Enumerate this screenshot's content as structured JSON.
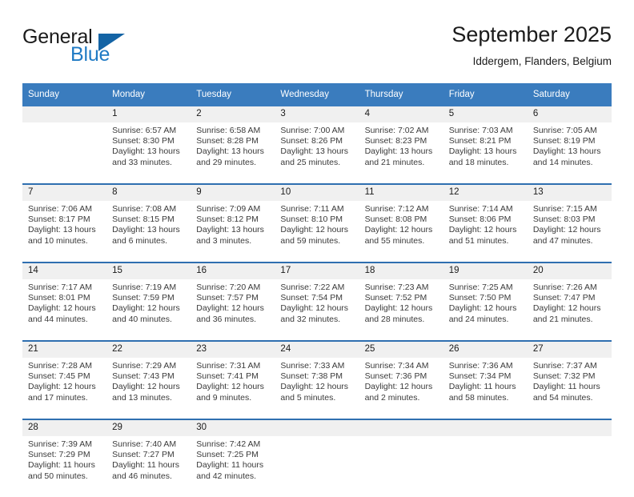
{
  "logo": {
    "word1": "General",
    "word2": "Blue",
    "triangle_color": "#1464a5",
    "blue_color": "#1f7ac4"
  },
  "header": {
    "title": "September 2025",
    "subtitle": "Iddergem, Flanders, Belgium"
  },
  "colors": {
    "header_blue": "#3a7cbe",
    "row_divider_blue": "#2f6fb0",
    "day_number_band": "#f0f0f0"
  },
  "calendar": {
    "weekdays": [
      "Sunday",
      "Monday",
      "Tuesday",
      "Wednesday",
      "Thursday",
      "Friday",
      "Saturday"
    ],
    "weeks": [
      {
        "days": [
          {
            "num": "",
            "sunrise": "",
            "sunset": "",
            "daylight1": "",
            "daylight2": ""
          },
          {
            "num": "1",
            "sunrise": "Sunrise: 6:57 AM",
            "sunset": "Sunset: 8:30 PM",
            "daylight1": "Daylight: 13 hours",
            "daylight2": "and 33 minutes."
          },
          {
            "num": "2",
            "sunrise": "Sunrise: 6:58 AM",
            "sunset": "Sunset: 8:28 PM",
            "daylight1": "Daylight: 13 hours",
            "daylight2": "and 29 minutes."
          },
          {
            "num": "3",
            "sunrise": "Sunrise: 7:00 AM",
            "sunset": "Sunset: 8:26 PM",
            "daylight1": "Daylight: 13 hours",
            "daylight2": "and 25 minutes."
          },
          {
            "num": "4",
            "sunrise": "Sunrise: 7:02 AM",
            "sunset": "Sunset: 8:23 PM",
            "daylight1": "Daylight: 13 hours",
            "daylight2": "and 21 minutes."
          },
          {
            "num": "5",
            "sunrise": "Sunrise: 7:03 AM",
            "sunset": "Sunset: 8:21 PM",
            "daylight1": "Daylight: 13 hours",
            "daylight2": "and 18 minutes."
          },
          {
            "num": "6",
            "sunrise": "Sunrise: 7:05 AM",
            "sunset": "Sunset: 8:19 PM",
            "daylight1": "Daylight: 13 hours",
            "daylight2": "and 14 minutes."
          }
        ]
      },
      {
        "days": [
          {
            "num": "7",
            "sunrise": "Sunrise: 7:06 AM",
            "sunset": "Sunset: 8:17 PM",
            "daylight1": "Daylight: 13 hours",
            "daylight2": "and 10 minutes."
          },
          {
            "num": "8",
            "sunrise": "Sunrise: 7:08 AM",
            "sunset": "Sunset: 8:15 PM",
            "daylight1": "Daylight: 13 hours",
            "daylight2": "and 6 minutes."
          },
          {
            "num": "9",
            "sunrise": "Sunrise: 7:09 AM",
            "sunset": "Sunset: 8:12 PM",
            "daylight1": "Daylight: 13 hours",
            "daylight2": "and 3 minutes."
          },
          {
            "num": "10",
            "sunrise": "Sunrise: 7:11 AM",
            "sunset": "Sunset: 8:10 PM",
            "daylight1": "Daylight: 12 hours",
            "daylight2": "and 59 minutes."
          },
          {
            "num": "11",
            "sunrise": "Sunrise: 7:12 AM",
            "sunset": "Sunset: 8:08 PM",
            "daylight1": "Daylight: 12 hours",
            "daylight2": "and 55 minutes."
          },
          {
            "num": "12",
            "sunrise": "Sunrise: 7:14 AM",
            "sunset": "Sunset: 8:06 PM",
            "daylight1": "Daylight: 12 hours",
            "daylight2": "and 51 minutes."
          },
          {
            "num": "13",
            "sunrise": "Sunrise: 7:15 AM",
            "sunset": "Sunset: 8:03 PM",
            "daylight1": "Daylight: 12 hours",
            "daylight2": "and 47 minutes."
          }
        ]
      },
      {
        "days": [
          {
            "num": "14",
            "sunrise": "Sunrise: 7:17 AM",
            "sunset": "Sunset: 8:01 PM",
            "daylight1": "Daylight: 12 hours",
            "daylight2": "and 44 minutes."
          },
          {
            "num": "15",
            "sunrise": "Sunrise: 7:19 AM",
            "sunset": "Sunset: 7:59 PM",
            "daylight1": "Daylight: 12 hours",
            "daylight2": "and 40 minutes."
          },
          {
            "num": "16",
            "sunrise": "Sunrise: 7:20 AM",
            "sunset": "Sunset: 7:57 PM",
            "daylight1": "Daylight: 12 hours",
            "daylight2": "and 36 minutes."
          },
          {
            "num": "17",
            "sunrise": "Sunrise: 7:22 AM",
            "sunset": "Sunset: 7:54 PM",
            "daylight1": "Daylight: 12 hours",
            "daylight2": "and 32 minutes."
          },
          {
            "num": "18",
            "sunrise": "Sunrise: 7:23 AM",
            "sunset": "Sunset: 7:52 PM",
            "daylight1": "Daylight: 12 hours",
            "daylight2": "and 28 minutes."
          },
          {
            "num": "19",
            "sunrise": "Sunrise: 7:25 AM",
            "sunset": "Sunset: 7:50 PM",
            "daylight1": "Daylight: 12 hours",
            "daylight2": "and 24 minutes."
          },
          {
            "num": "20",
            "sunrise": "Sunrise: 7:26 AM",
            "sunset": "Sunset: 7:47 PM",
            "daylight1": "Daylight: 12 hours",
            "daylight2": "and 21 minutes."
          }
        ]
      },
      {
        "days": [
          {
            "num": "21",
            "sunrise": "Sunrise: 7:28 AM",
            "sunset": "Sunset: 7:45 PM",
            "daylight1": "Daylight: 12 hours",
            "daylight2": "and 17 minutes."
          },
          {
            "num": "22",
            "sunrise": "Sunrise: 7:29 AM",
            "sunset": "Sunset: 7:43 PM",
            "daylight1": "Daylight: 12 hours",
            "daylight2": "and 13 minutes."
          },
          {
            "num": "23",
            "sunrise": "Sunrise: 7:31 AM",
            "sunset": "Sunset: 7:41 PM",
            "daylight1": "Daylight: 12 hours",
            "daylight2": "and 9 minutes."
          },
          {
            "num": "24",
            "sunrise": "Sunrise: 7:33 AM",
            "sunset": "Sunset: 7:38 PM",
            "daylight1": "Daylight: 12 hours",
            "daylight2": "and 5 minutes."
          },
          {
            "num": "25",
            "sunrise": "Sunrise: 7:34 AM",
            "sunset": "Sunset: 7:36 PM",
            "daylight1": "Daylight: 12 hours",
            "daylight2": "and 2 minutes."
          },
          {
            "num": "26",
            "sunrise": "Sunrise: 7:36 AM",
            "sunset": "Sunset: 7:34 PM",
            "daylight1": "Daylight: 11 hours",
            "daylight2": "and 58 minutes."
          },
          {
            "num": "27",
            "sunrise": "Sunrise: 7:37 AM",
            "sunset": "Sunset: 7:32 PM",
            "daylight1": "Daylight: 11 hours",
            "daylight2": "and 54 minutes."
          }
        ]
      },
      {
        "days": [
          {
            "num": "28",
            "sunrise": "Sunrise: 7:39 AM",
            "sunset": "Sunset: 7:29 PM",
            "daylight1": "Daylight: 11 hours",
            "daylight2": "and 50 minutes."
          },
          {
            "num": "29",
            "sunrise": "Sunrise: 7:40 AM",
            "sunset": "Sunset: 7:27 PM",
            "daylight1": "Daylight: 11 hours",
            "daylight2": "and 46 minutes."
          },
          {
            "num": "30",
            "sunrise": "Sunrise: 7:42 AM",
            "sunset": "Sunset: 7:25 PM",
            "daylight1": "Daylight: 11 hours",
            "daylight2": "and 42 minutes."
          },
          {
            "num": "",
            "sunrise": "",
            "sunset": "",
            "daylight1": "",
            "daylight2": ""
          },
          {
            "num": "",
            "sunrise": "",
            "sunset": "",
            "daylight1": "",
            "daylight2": ""
          },
          {
            "num": "",
            "sunrise": "",
            "sunset": "",
            "daylight1": "",
            "daylight2": ""
          },
          {
            "num": "",
            "sunrise": "",
            "sunset": "",
            "daylight1": "",
            "daylight2": ""
          }
        ]
      }
    ]
  }
}
